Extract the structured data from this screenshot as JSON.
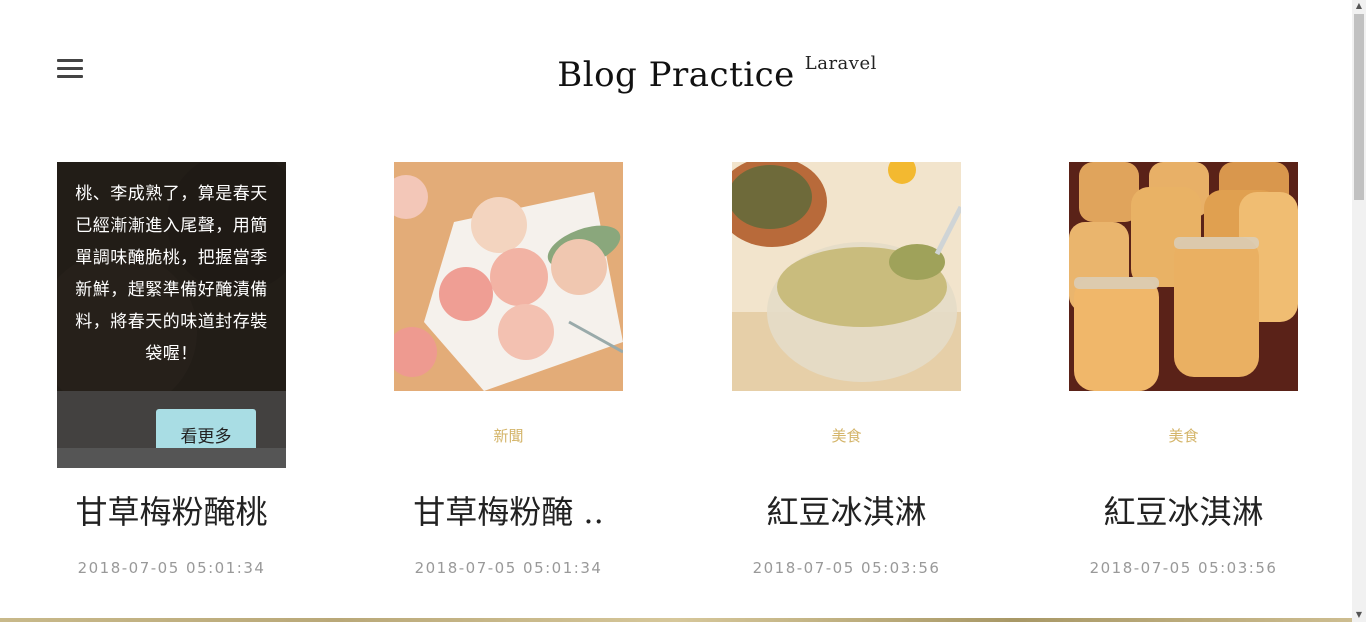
{
  "header": {
    "title": "Blog Practice",
    "subtitle": "Laravel"
  },
  "posts": [
    {
      "excerpt": "桃、李成熟了，算是春天已經漸漸進入尾聲，用簡單調味醃脆桃，把握當季新鮮，趕緊準備好醃漬備料，將春天的味道封存裝袋喔！",
      "more_label": "看更多",
      "title": "甘草梅粉醃桃",
      "date": "2018-07-05 05:01:34"
    },
    {
      "category": "新聞",
      "title": "甘草梅粉醃 ..",
      "date": "2018-07-05 05:01:34"
    },
    {
      "category": "美食",
      "title": "紅豆冰淇淋",
      "date": "2018-07-05 05:03:56"
    },
    {
      "category": "美食",
      "title": "紅豆冰淇淋",
      "date": "2018-07-05 05:03:56"
    }
  ],
  "icons": {
    "menu": "hamburger-menu-icon",
    "scroll_up": "chevron-up-icon",
    "scroll_down": "chevron-down-icon"
  }
}
